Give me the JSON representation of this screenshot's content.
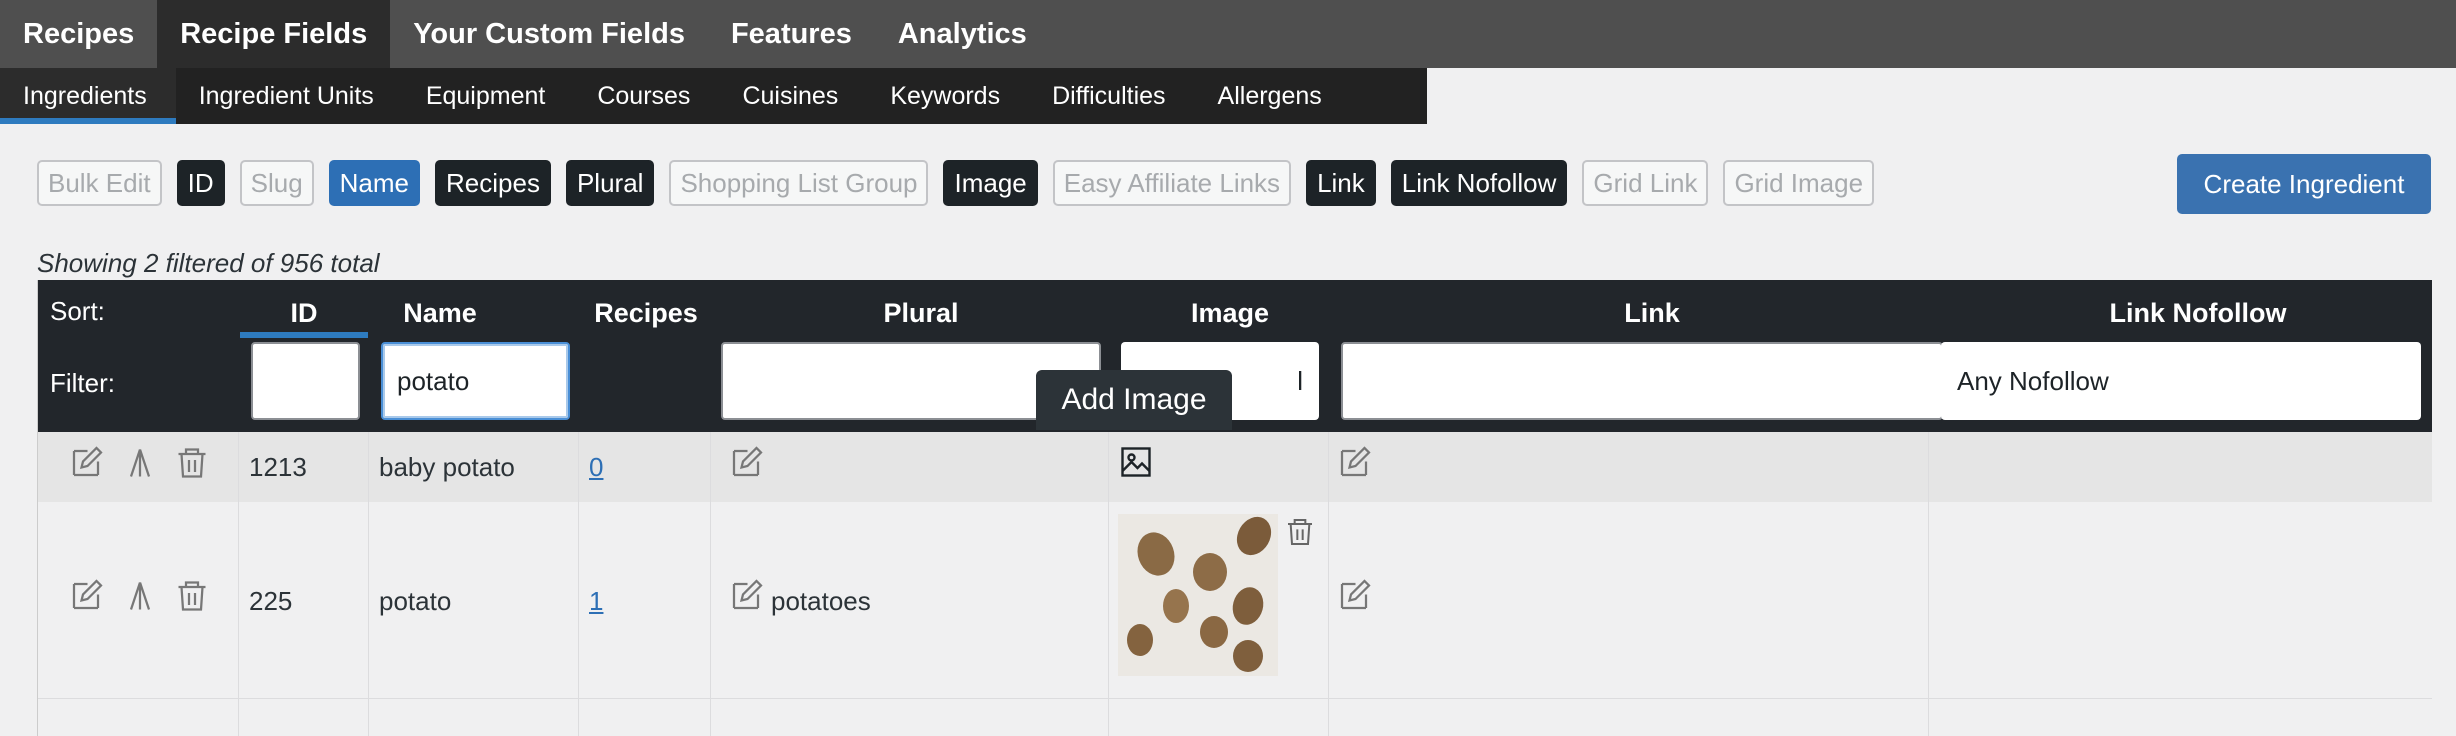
{
  "top_tabs": [
    "Recipes",
    "Recipe Fields",
    "Your Custom Fields",
    "Features",
    "Analytics"
  ],
  "sub_tabs": [
    "Ingredients",
    "Ingredient Units",
    "Equipment",
    "Courses",
    "Cuisines",
    "Keywords",
    "Difficulties",
    "Allergens"
  ],
  "toggles": [
    {
      "label": "Bulk Edit",
      "state": "off"
    },
    {
      "label": "ID",
      "state": "on"
    },
    {
      "label": "Slug",
      "state": "off"
    },
    {
      "label": "Name",
      "state": "active"
    },
    {
      "label": "Recipes",
      "state": "on"
    },
    {
      "label": "Plural",
      "state": "on"
    },
    {
      "label": "Shopping List Group",
      "state": "off"
    },
    {
      "label": "Image",
      "state": "on"
    },
    {
      "label": "Easy Affiliate Links",
      "state": "off"
    },
    {
      "label": "Link",
      "state": "on"
    },
    {
      "label": "Link Nofollow",
      "state": "on"
    },
    {
      "label": "Grid Link",
      "state": "off"
    },
    {
      "label": "Grid Image",
      "state": "off"
    }
  ],
  "create_button": "Create Ingredient",
  "showing_text": "Showing 2 filtered of 956 total",
  "table": {
    "sort_label": "Sort:",
    "filter_label": "Filter:",
    "columns": {
      "id": "ID",
      "name": "Name",
      "recipes": "Recipes",
      "plural": "Plural",
      "image": "Image",
      "link": "Link",
      "link_nofollow": "Link Nofollow"
    },
    "filters": {
      "name_value": "potato",
      "image_select_partial": "l",
      "nofollow_select": "Any Nofollow"
    },
    "rows": [
      {
        "id": "1213",
        "name": "baby potato",
        "recipes": "0",
        "plural": ""
      },
      {
        "id": "225",
        "name": "potato",
        "recipes": "1",
        "plural": "potatoes"
      }
    ]
  },
  "tooltip": "Add Image",
  "colors": {
    "accent": "#2d6fb5",
    "header_bg": "#22262b",
    "topnav_bg": "#4f4f4f"
  }
}
